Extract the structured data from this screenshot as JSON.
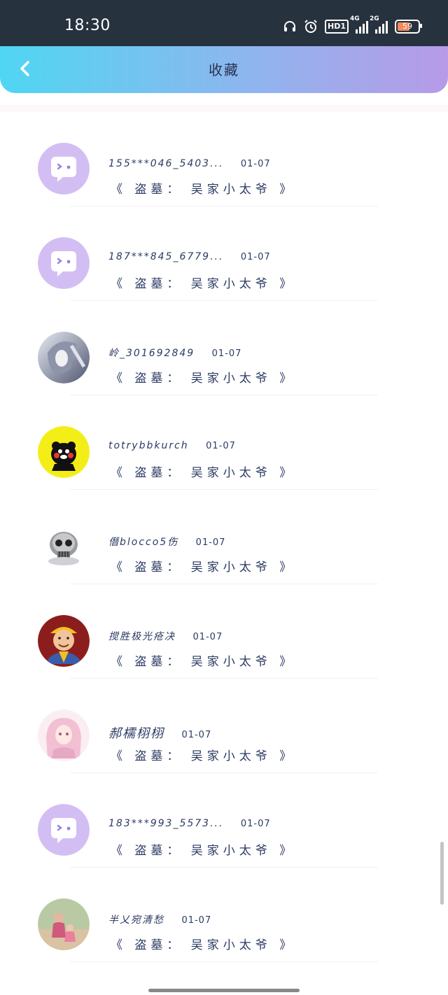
{
  "status_bar": {
    "time": "18:30",
    "icons": [
      "headset-icon",
      "alarm-icon",
      "hd-icon",
      "signal-4g-icon",
      "signal-2g-icon",
      "battery-icon"
    ],
    "hd_label": "HD1",
    "network_1": "4G",
    "network_2": "2G",
    "battery_level": "59"
  },
  "header": {
    "title": "收藏",
    "back_icon": "chevron-left-icon"
  },
  "colors": {
    "header_gradient_start": "#4fd6f2",
    "header_gradient_end": "#b79ae8",
    "text": "#2b3a63",
    "status_bar_bg": "#27323f"
  },
  "items": [
    {
      "name": "155***046_5403...",
      "date": "01-07",
      "book": "《 盗墓： 吴家小太爷 》",
      "avatar": "default-chat-avatar"
    },
    {
      "name": "187***845_6779...",
      "date": "01-07",
      "book": "《 盗墓： 吴家小太爷 》",
      "avatar": "default-chat-avatar"
    },
    {
      "name": "岭_301692849",
      "date": "01-07",
      "book": "《 盗墓： 吴家小太爷 》",
      "avatar": "anime-character-avatar"
    },
    {
      "name": "totrybbkurch",
      "date": "01-07",
      "book": "《 盗墓： 吴家小太爷 》",
      "avatar": "kumamon-avatar"
    },
    {
      "name": "僭blocco5伤",
      "date": "01-07",
      "book": "《 盗墓： 吴家小太爷 》",
      "avatar": "skull-ring-avatar"
    },
    {
      "name": "搅胜极光疮决",
      "date": "01-07",
      "book": "《 盗墓： 吴家小太爷 》",
      "avatar": "cartoon-man-avatar"
    },
    {
      "name": "郝檽栩栩",
      "date": "01-07",
      "book": "《 盗墓： 吴家小太爷 》",
      "avatar": "anime-girl-avatar"
    },
    {
      "name": "183***993_5573...",
      "date": "01-07",
      "book": "《 盗墓： 吴家小太爷 》",
      "avatar": "default-chat-avatar"
    },
    {
      "name": "半乂宛清愁",
      "date": "01-07",
      "book": "《 盗墓： 吴家小太爷 》",
      "avatar": "photo-avatar"
    }
  ]
}
